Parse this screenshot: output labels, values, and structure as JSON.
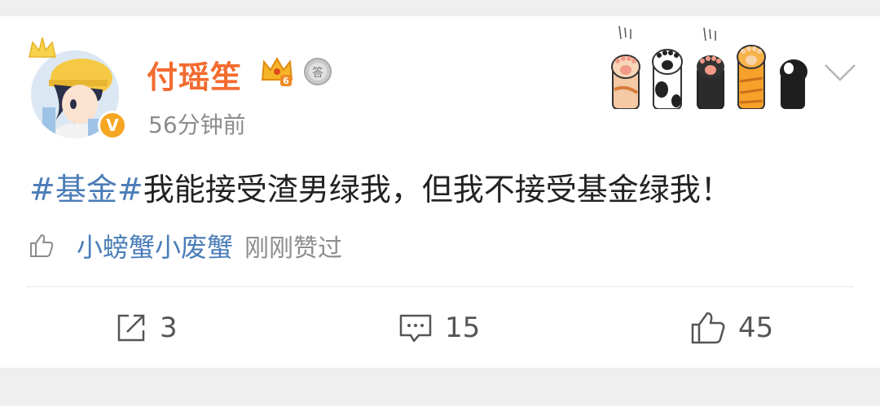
{
  "post": {
    "author": "付瑶笙",
    "timestamp": "56分钟前",
    "hashtag": "#基金#",
    "body": "我能接受渣男绿我，但我不接受基金绿我！",
    "liker_name": "小螃蟹小废蟹",
    "liked_text": "刚刚赞过"
  },
  "actions": {
    "share_count": "3",
    "comment_count": "15",
    "like_count": "45"
  },
  "badges": {
    "verified": "V",
    "crown_level": "6",
    "medal": "答"
  },
  "icons": {
    "avatar": "cartoon-avatar",
    "verified": "verified-badge-icon",
    "crown": "crown-icon",
    "medal": "medal-icon",
    "paws": "cat-paws-decoration",
    "menu": "chevron-down-icon",
    "like_small": "thumbs-up-icon",
    "share": "share-icon",
    "comment": "comment-icon",
    "like": "thumbs-up-icon"
  },
  "colors": {
    "username": "#f36b2f",
    "hashtag": "#4a7db8",
    "muted": "#8c8c8c",
    "background": "#efefef"
  }
}
